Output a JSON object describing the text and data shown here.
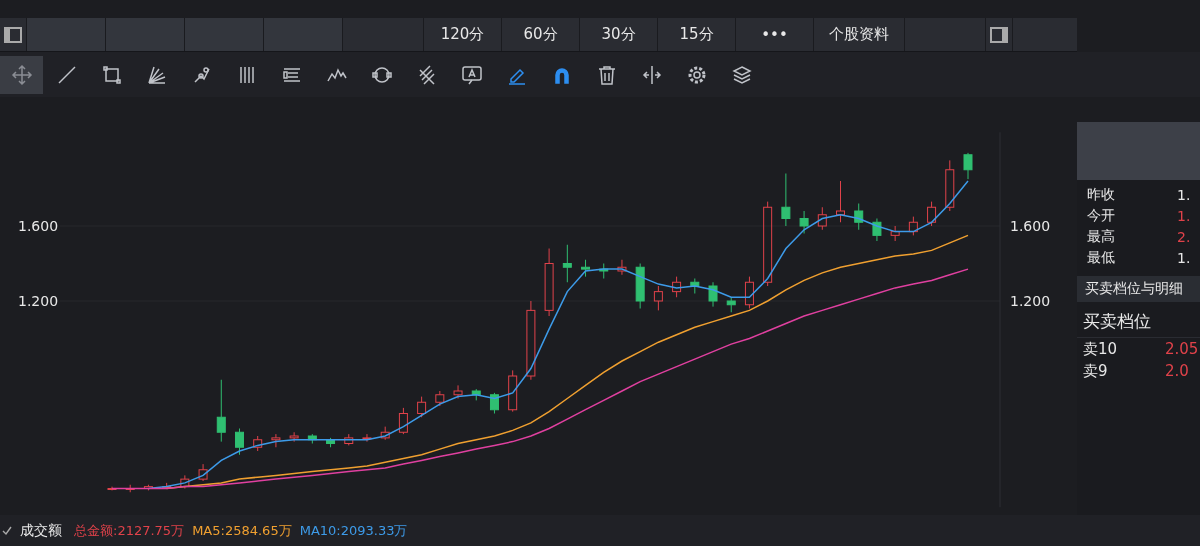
{
  "period_tabs": [
    {
      "label": "120分",
      "selected": false
    },
    {
      "label": "60分",
      "selected": false
    },
    {
      "label": "30分",
      "selected": false
    },
    {
      "label": "15分",
      "selected": false
    },
    {
      "label": "•••",
      "selected": false
    },
    {
      "label": "个股资料",
      "selected": false
    }
  ],
  "tools": [
    {
      "kind": "move",
      "selected": true,
      "on": false
    },
    {
      "kind": "line",
      "selected": false,
      "on": false
    },
    {
      "kind": "rect",
      "selected": false,
      "on": false
    },
    {
      "kind": "fan",
      "selected": false,
      "on": false
    },
    {
      "kind": "nodes",
      "selected": false,
      "on": false
    },
    {
      "kind": "bars",
      "selected": false,
      "on": false
    },
    {
      "kind": "text-lines",
      "selected": false,
      "on": false
    },
    {
      "kind": "zigzag",
      "selected": false,
      "on": false
    },
    {
      "kind": "cycle",
      "selected": false,
      "on": false
    },
    {
      "kind": "fork",
      "selected": false,
      "on": false
    },
    {
      "kind": "label",
      "selected": false,
      "on": false
    },
    {
      "kind": "pen",
      "selected": false,
      "on": true
    },
    {
      "kind": "magnet",
      "selected": false,
      "on": true
    },
    {
      "kind": "trash",
      "selected": false,
      "on": false
    },
    {
      "kind": "split",
      "selected": false,
      "on": false
    },
    {
      "kind": "gear",
      "selected": false,
      "on": false
    },
    {
      "kind": "layers",
      "selected": false,
      "on": false
    }
  ],
  "chart": {
    "chart_data": {
      "type": "candlestick",
      "ylim": [
        0.1,
        2.1
      ],
      "yticks": [
        {
          "value": 1.2,
          "label": "1.200"
        },
        {
          "value": 1.6,
          "label": "1.600"
        }
      ],
      "ohlc": [
        [
          0.2,
          0.21,
          0.19,
          0.2
        ],
        [
          0.2,
          0.22,
          0.18,
          0.2
        ],
        [
          0.2,
          0.22,
          0.19,
          0.21
        ],
        [
          0.21,
          0.23,
          0.2,
          0.21
        ],
        [
          0.21,
          0.27,
          0.2,
          0.25
        ],
        [
          0.25,
          0.33,
          0.24,
          0.3
        ],
        [
          0.58,
          0.78,
          0.45,
          0.5
        ],
        [
          0.5,
          0.52,
          0.38,
          0.42
        ],
        [
          0.42,
          0.48,
          0.4,
          0.46
        ],
        [
          0.46,
          0.49,
          0.42,
          0.47
        ],
        [
          0.47,
          0.5,
          0.45,
          0.48
        ],
        [
          0.48,
          0.49,
          0.44,
          0.46
        ],
        [
          0.46,
          0.47,
          0.42,
          0.44
        ],
        [
          0.44,
          0.49,
          0.43,
          0.47
        ],
        [
          0.47,
          0.49,
          0.45,
          0.47
        ],
        [
          0.47,
          0.53,
          0.46,
          0.5
        ],
        [
          0.5,
          0.63,
          0.49,
          0.6
        ],
        [
          0.6,
          0.69,
          0.58,
          0.66
        ],
        [
          0.66,
          0.72,
          0.64,
          0.7
        ],
        [
          0.7,
          0.75,
          0.68,
          0.72
        ],
        [
          0.72,
          0.73,
          0.67,
          0.7
        ],
        [
          0.7,
          0.71,
          0.6,
          0.62
        ],
        [
          0.62,
          0.83,
          0.61,
          0.8
        ],
        [
          0.8,
          1.2,
          0.78,
          1.15
        ],
        [
          1.15,
          1.48,
          1.12,
          1.4
        ],
        [
          1.4,
          1.5,
          1.3,
          1.38
        ],
        [
          1.38,
          1.42,
          1.33,
          1.37
        ],
        [
          1.37,
          1.4,
          1.32,
          1.36
        ],
        [
          1.36,
          1.42,
          1.34,
          1.38
        ],
        [
          1.38,
          1.4,
          1.16,
          1.2
        ],
        [
          1.2,
          1.28,
          1.15,
          1.25
        ],
        [
          1.25,
          1.33,
          1.22,
          1.3
        ],
        [
          1.3,
          1.32,
          1.24,
          1.28
        ],
        [
          1.28,
          1.3,
          1.17,
          1.2
        ],
        [
          1.2,
          1.22,
          1.14,
          1.18
        ],
        [
          1.18,
          1.33,
          1.16,
          1.3
        ],
        [
          1.3,
          1.73,
          1.28,
          1.7
        ],
        [
          1.7,
          1.88,
          1.6,
          1.64
        ],
        [
          1.64,
          1.68,
          1.56,
          1.6
        ],
        [
          1.6,
          1.7,
          1.58,
          1.66
        ],
        [
          1.66,
          1.84,
          1.62,
          1.68
        ],
        [
          1.68,
          1.72,
          1.58,
          1.62
        ],
        [
          1.62,
          1.64,
          1.52,
          1.55
        ],
        [
          1.55,
          1.6,
          1.52,
          1.57
        ],
        [
          1.57,
          1.65,
          1.55,
          1.62
        ],
        [
          1.62,
          1.73,
          1.6,
          1.7
        ],
        [
          1.7,
          1.95,
          1.68,
          1.9
        ],
        [
          1.98,
          1.99,
          1.85,
          1.9
        ]
      ],
      "series": [
        {
          "type": "line",
          "color": "#3d9be9",
          "values": [
            null,
            null,
            0.2,
            0.21,
            0.23,
            0.27,
            0.35,
            0.4,
            0.43,
            0.45,
            0.46,
            0.46,
            0.46,
            0.46,
            0.46,
            0.48,
            0.53,
            0.59,
            0.65,
            0.69,
            0.7,
            0.68,
            0.71,
            0.84,
            1.05,
            1.25,
            1.36,
            1.37,
            1.37,
            1.33,
            1.29,
            1.27,
            1.28,
            1.26,
            1.22,
            1.22,
            1.32,
            1.48,
            1.58,
            1.64,
            1.66,
            1.64,
            1.6,
            1.57,
            1.57,
            1.62,
            1.72,
            1.84
          ]
        },
        {
          "type": "line",
          "color": "#f0a030",
          "values": [
            null,
            null,
            null,
            0.2,
            0.21,
            0.22,
            0.23,
            0.25,
            0.26,
            0.27,
            0.28,
            0.29,
            0.3,
            0.31,
            0.32,
            0.34,
            0.36,
            0.38,
            0.41,
            0.44,
            0.46,
            0.48,
            0.51,
            0.55,
            0.61,
            0.68,
            0.75,
            0.82,
            0.88,
            0.93,
            0.98,
            1.02,
            1.06,
            1.09,
            1.12,
            1.15,
            1.2,
            1.26,
            1.31,
            1.35,
            1.38,
            1.4,
            1.42,
            1.44,
            1.45,
            1.47,
            1.51,
            1.55
          ]
        },
        {
          "type": "line",
          "color": "#e040a0",
          "values": [
            0.2,
            0.2,
            0.2,
            0.2,
            0.21,
            0.21,
            0.22,
            0.23,
            0.24,
            0.25,
            0.26,
            0.27,
            0.28,
            0.29,
            0.3,
            0.31,
            0.33,
            0.35,
            0.37,
            0.39,
            0.41,
            0.43,
            0.45,
            0.48,
            0.52,
            0.57,
            0.62,
            0.67,
            0.72,
            0.77,
            0.81,
            0.85,
            0.89,
            0.93,
            0.97,
            1.0,
            1.04,
            1.08,
            1.12,
            1.15,
            1.18,
            1.21,
            1.24,
            1.27,
            1.29,
            1.31,
            1.34,
            1.37
          ]
        }
      ]
    }
  },
  "quote": {
    "rows": [
      {
        "label": "昨收",
        "value": "1.",
        "color": "#e8e8e8"
      },
      {
        "label": "今开",
        "value": "1.",
        "color": "#e0424a"
      },
      {
        "label": "最高",
        "value": "2.",
        "color": "#e0424a"
      },
      {
        "label": "最低",
        "value": "1.",
        "color": "#e8e8e8"
      }
    ],
    "detail_header": "买卖档位与明细",
    "book_title": "买卖档位",
    "book": [
      {
        "label": "卖10",
        "value": "2.05"
      },
      {
        "label": "卖9",
        "value": "2.0"
      }
    ]
  },
  "volume_bar": {
    "title": "成交额",
    "items": [
      {
        "text": "总金额:2127.75万",
        "color": "#e0424a"
      },
      {
        "text": "MA5:2584.65万",
        "color": "#f0a030"
      },
      {
        "text": "MA10:2093.33万",
        "color": "#3d9be9"
      }
    ]
  }
}
